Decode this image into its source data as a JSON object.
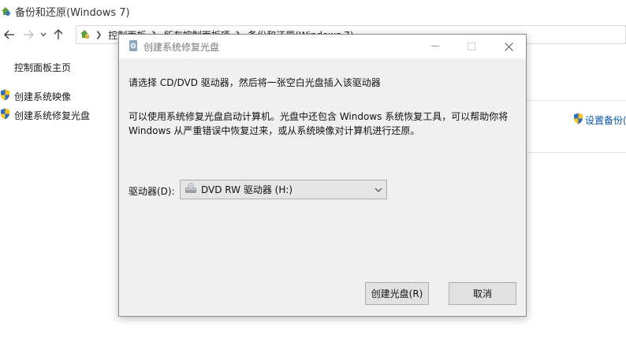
{
  "background_window": {
    "title": "备份和还原(Windows 7)",
    "breadcrumbs": [
      "控制面板",
      "所有控制面板项",
      "备份和还原(Windows 7)"
    ],
    "sidebar": {
      "home": "控制面板主页",
      "links": [
        "创建系统映像",
        "创建系统修复光盘"
      ]
    },
    "setup_backup_link": "设置备份(S)"
  },
  "dialog": {
    "title": "创建系统修复光盘",
    "instruction": "请选择 CD/DVD 驱动器，然后将一张空白光盘插入该驱动器",
    "description_line1": "可以使用系统修复光盘启动计算机。光盘中还包含 Windows 系统恢复工具，可以帮助你将",
    "description_line2": "Windows 从严重错误中恢复过来，或从系统映像对计算机进行还原。",
    "drive_label": "驱动器(D):",
    "drive_selected": "DVD RW 驱动器 (H:)",
    "create_button": "创建光盘(R)",
    "cancel_button": "取消"
  },
  "icons": {
    "back": "back-arrow-icon",
    "forward": "forward-arrow-icon",
    "recent": "recent-locations-icon",
    "up": "up-arrow-icon",
    "shield": "uac-shield-icon",
    "drive": "dvd-drive-icon"
  },
  "colors": {
    "link_blue": "#0b57a4",
    "dialog_bg": "#f0f0f0",
    "button_bg": "#e1e1e1"
  }
}
